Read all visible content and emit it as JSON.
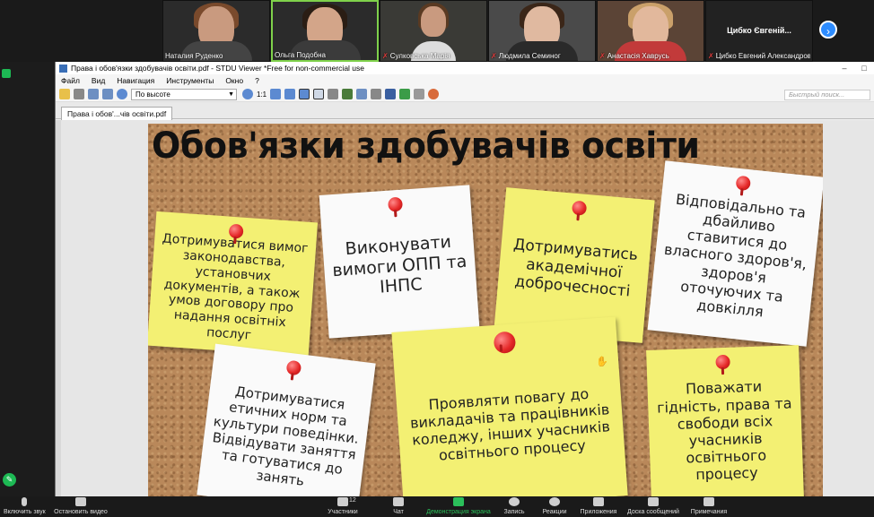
{
  "gallery": {
    "participants": [
      {
        "name": "Наталия Руденко",
        "muted": false
      },
      {
        "name": "Ольга Подобна",
        "muted": false
      },
      {
        "name": "Сулковська Марія",
        "muted": true
      },
      {
        "name": "Людмила Семиног",
        "muted": true
      },
      {
        "name": "Анастасія Хаврусь",
        "muted": true
      },
      {
        "name": "Цибко Евгений Александров...",
        "display_title": "Цибко Євгеній...",
        "muted": true
      }
    ],
    "next_icon": "chevron-right-icon"
  },
  "viewer": {
    "title": "Права і обов'язки здобувачів освіти.pdf - STDU Viewer *Free for non-commercial use",
    "menu": [
      "Файл",
      "Вид",
      "Навигация",
      "Инструменты",
      "Окно",
      "?"
    ],
    "zoom_mode": "По высоте",
    "page_ratio": "1:1",
    "search_placeholder": "Быстрый поиск...",
    "tab_label": "Права і обов'...чів освіти.pdf"
  },
  "slide": {
    "title": "Обов'язки здобувачів освіти",
    "notes": [
      "Дотримуватися вимог законодавства, установчих документів, а також умов договору про надання освітніх послуг",
      "Виконувати вимоги ОПП та ІНПС",
      "Дотримуватись академічної доброчесності",
      "Відповідально та дбайливо ставитися до власного здоров'я, здоров'я оточуючих та довкілля",
      "Дотримуватися етичних норм та культури поведінки. Відвідувати заняття та готуватися до занять",
      "Проявляти повагу до викладачів та працівників коледжу, інших учасників освітнього процесу",
      "Поважати гідність, права та свободи всіх учасників освітнього процесу"
    ]
  },
  "controls": {
    "participants_count": "12",
    "labels": [
      "Включить звук",
      "Остановить видео",
      "Участники",
      "Чат",
      "Демонстрация экрана",
      "Запись",
      "Реакции",
      "Приложения",
      "Доска сообщений",
      "Примечания"
    ]
  },
  "colors": {
    "zoom_blue": "#2d8cff",
    "note_yellow": "#f3f073",
    "pin_red": "#e52828",
    "active_speaker": "#7fd14b"
  }
}
